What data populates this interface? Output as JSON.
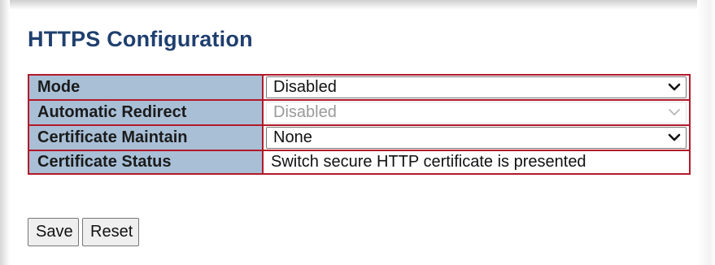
{
  "page": {
    "title": "HTTPS Configuration"
  },
  "config": {
    "rows": [
      {
        "label": "Mode",
        "value": "Disabled",
        "type": "select",
        "disabled": false
      },
      {
        "label": "Automatic Redirect",
        "value": "Disabled",
        "type": "select",
        "disabled": true
      },
      {
        "label": "Certificate Maintain",
        "value": "None",
        "type": "select",
        "disabled": false
      },
      {
        "label": "Certificate Status",
        "value": "Switch secure HTTP certificate is presented",
        "type": "text",
        "disabled": false
      }
    ]
  },
  "buttons": {
    "save_label": "Save",
    "reset_label": "Reset"
  },
  "colors": {
    "title": "#1f3f6e",
    "label_bg": "#a8bfd6",
    "table_border": "#b2192a"
  },
  "icons": {
    "dropdown": "chevron-down-icon"
  }
}
